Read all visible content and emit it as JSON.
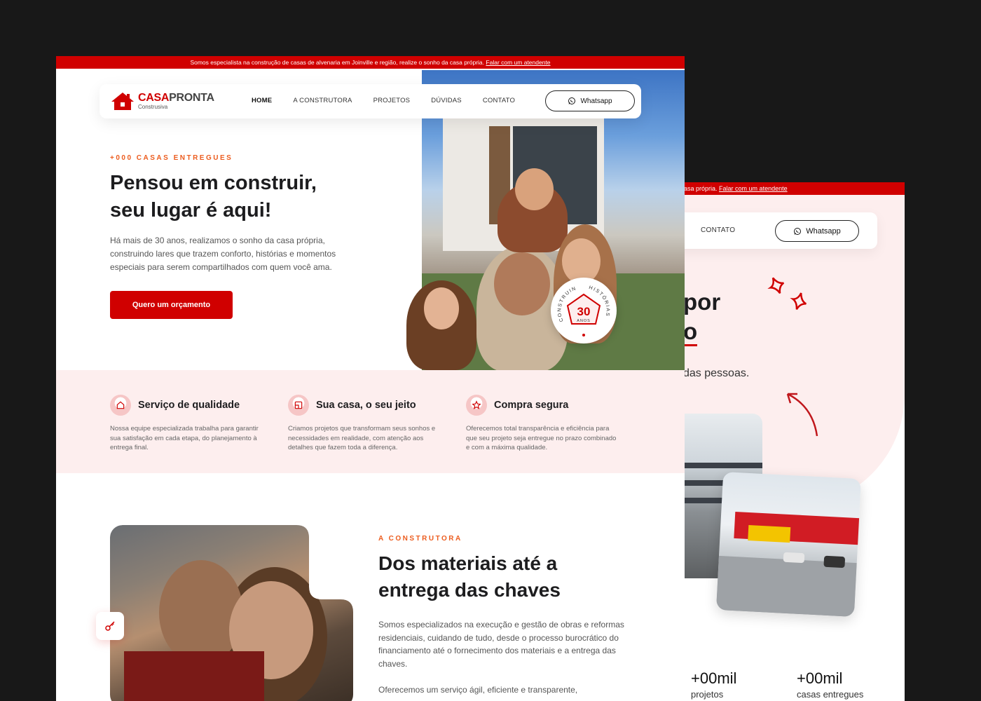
{
  "brand": {
    "name_part1": "CASA",
    "name_part2": "PRONTA",
    "tagline": "Construsiva",
    "accent": "#d00000",
    "eyebrow_color": "#ec5c1e",
    "pink_bg": "#fdeeee"
  },
  "topbar": {
    "text": "Somos especialista na construção de casas de alvenaria em Joinville e região, realize o sonho da casa própria.",
    "link": "Falar com um atendente"
  },
  "nav": {
    "items": [
      "HOME",
      "A CONSTRUTORA",
      "PROJETOS",
      "DÚVIDAS",
      "CONTATO"
    ],
    "whatsapp_label": "Whatsapp"
  },
  "hero": {
    "eyebrow": "+000 CASAS ENTREGUES",
    "title_line1": "Pensou em construir,",
    "title_line2": "seu lugar é aqui!",
    "lead": "Há mais de 30 anos, realizamos o sonho da casa própria, construindo lares que trazem conforto, histórias e momentos especiais para serem compartilhados com quem você ama.",
    "cta": "Quero um orçamento",
    "badge": {
      "number": "30",
      "unit": "ANOS",
      "ring_left": "CONSTRUINDO",
      "ring_right": "HISTÓRIAS"
    }
  },
  "features": [
    {
      "icon": "house-icon",
      "title": "Serviço de qualidade",
      "desc": "Nossa equipe especializada trabalha para garantir sua satisfação em cada etapa, do planejamento à entrega final."
    },
    {
      "icon": "blueprint-icon",
      "title": "Sua casa, o seu jeito",
      "desc": "Criamos projetos que transformam seus sonhos e necessidades em realidade, com atenção aos detalhes que fazem toda a diferença."
    },
    {
      "icon": "star-icon",
      "title": "Compra segura",
      "desc": "Oferecemos total transparência e eficiência para que seu projeto seja entregue no prazo combinado e com a máxima qualidade."
    }
  ],
  "about": {
    "eyebrow": "A CONSTRUTORA",
    "title_line1": "Dos materiais até a",
    "title_line2": "entrega das chaves",
    "para1": "Somos especializados na execução e gestão de obras e reformas residenciais, cuidando de tudo, desde o processo burocrático do financiamento até o fornecimento dos materiais e a entrega das chaves.",
    "para2": "Oferecemos um serviço ágil, eficiente e transparente,"
  },
  "back_screen": {
    "topbar_text": "asa própria.",
    "topbar_link": "Falar com um atendente",
    "nav_item": "CONTATO",
    "whatsapp_label": "Whatsapp",
    "big_line1": "por",
    "big_line2": "o",
    "sub": "das pessoas.",
    "stats": [
      {
        "value": "+00mil",
        "label": "projetos"
      },
      {
        "value": "+00mil",
        "label": "casas entregues"
      }
    ]
  }
}
